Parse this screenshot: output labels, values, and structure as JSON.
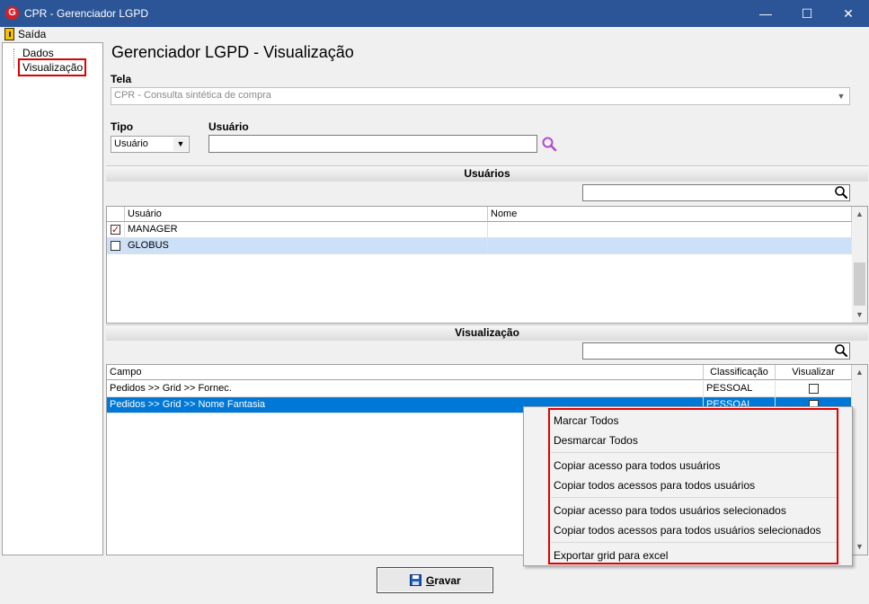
{
  "window": {
    "title": "CPR - Gerenciador LGPD",
    "app_icon_letter": "G",
    "minimize": "—",
    "maximize": "☐",
    "close": "✕"
  },
  "menu": {
    "exit_label": "Saída"
  },
  "tree": {
    "items": [
      {
        "label": "Dados"
      },
      {
        "label": "Visualização",
        "selected": true
      }
    ]
  },
  "page_title": "Gerenciador LGPD - Visualização",
  "tela": {
    "label": "Tela",
    "value": "CPR - Consulta sintética de compra"
  },
  "tipo": {
    "label": "Tipo",
    "value": "Usuário"
  },
  "usuario": {
    "label": "Usuário",
    "value": ""
  },
  "users_section": {
    "title": "Usuários",
    "search_value": "",
    "columns": [
      "Usuário",
      "Nome"
    ],
    "rows": [
      {
        "checked": true,
        "usuario": "MANAGER",
        "nome": ""
      },
      {
        "checked": false,
        "usuario": "GLOBUS",
        "nome": ""
      }
    ]
  },
  "view_section": {
    "title": "Visualização",
    "search_value": "",
    "columns": [
      "Campo",
      "Classificação",
      "Visualizar"
    ],
    "rows": [
      {
        "campo": "Pedidos >> Grid >> Fornec.",
        "classificacao": "PESSOAL",
        "visualizar": false
      },
      {
        "campo": "Pedidos >> Grid >> Nome Fantasia",
        "classificacao": "PESSOAL",
        "visualizar": false
      }
    ]
  },
  "context_menu": {
    "items": [
      "Marcar Todos",
      "Desmarcar Todos",
      "Copiar acesso para todos usuários",
      "Copiar todos acessos para todos usuários",
      "Copiar acesso para todos usuários selecionados",
      "Copiar todos acessos para todos usuários selecionados",
      "Exportar grid para excel"
    ]
  },
  "save_button": {
    "label": "Gravar"
  },
  "colors": {
    "titlebar": "#2b5597",
    "selection": "#0078d7",
    "row_highlight": "#cce0f7",
    "annotation_red": "#e00000"
  }
}
